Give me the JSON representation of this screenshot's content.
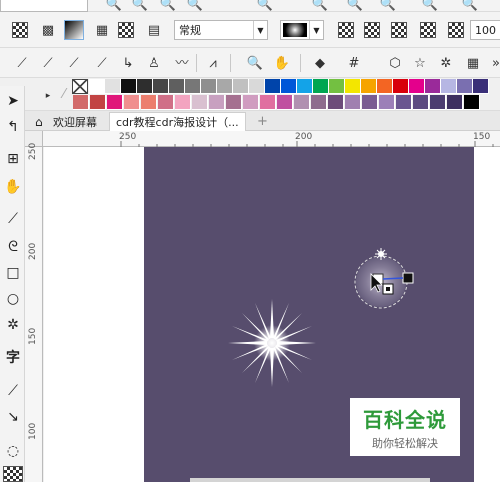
{
  "toolbar_top": {
    "style_combo": "常规",
    "zoom_value": "100"
  },
  "palette": {
    "row1": [
      "#ffffff",
      "#e1e1e1",
      "#111111",
      "#2e2e2e",
      "#474747",
      "#5f5f5f",
      "#777777",
      "#8f8f8f",
      "#a8a8a8",
      "#c0c0c0",
      "#d9d9d9",
      "#0044aa",
      "#0057d8",
      "#13a3e8",
      "#00a651",
      "#73c041",
      "#f3e600",
      "#f6a400",
      "#f36523",
      "#d8000b",
      "#e4008c",
      "#9a2a9a",
      "#b6b6e3",
      "#7a6fb0",
      "#3a2f78"
    ],
    "row2": [
      "#d26a6a",
      "#c24343",
      "#e0177a",
      "#f08f8f",
      "#ec7e6e",
      "#d06f87",
      "#f3a4c0",
      "#d9c0d0",
      "#c8a0c0",
      "#a57090",
      "#d09cc0",
      "#e06fa0",
      "#c050a0",
      "#b090b0",
      "#8e6c8e",
      "#6d4c7a",
      "#a080b0",
      "#7a5c92",
      "#9c7fb8",
      "#6a5590",
      "#5c4a80",
      "#4c3c70",
      "#3e2f60",
      "#000000"
    ]
  },
  "tabs": {
    "welcome": "欢迎屏幕",
    "document": "cdr教程cdr海报设计（...",
    "add": "+"
  },
  "ruler": {
    "h_labels": [
      "250",
      "200",
      "150"
    ],
    "v_labels": [
      "250",
      "200",
      "150",
      "100"
    ]
  },
  "watermark": {
    "title": "百科全说",
    "subtitle": "助你轻松解决"
  },
  "colors": {
    "page_bg": "#574d6d",
    "watermark_green": "#2e9a3a"
  }
}
